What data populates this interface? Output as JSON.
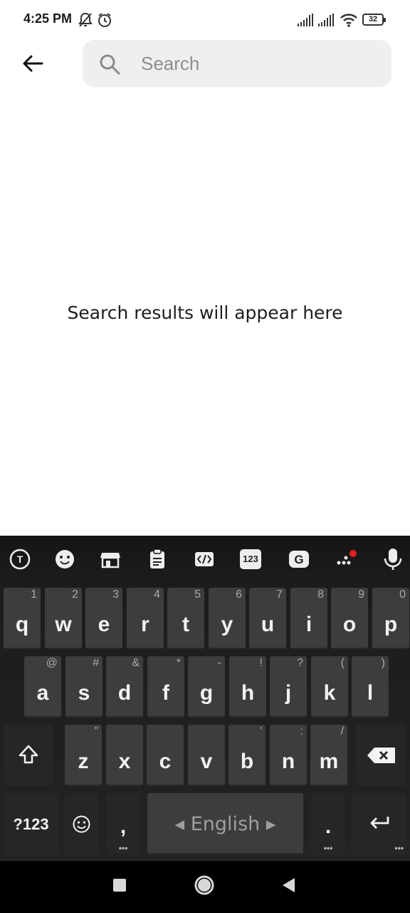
{
  "status": {
    "time": "4:25 PM",
    "battery": "32",
    "icons": [
      "bell-off-icon",
      "alarm-icon",
      "signal-icon",
      "signal-icon",
      "wifi-icon",
      "battery-icon"
    ]
  },
  "header": {
    "back_icon": "arrow-left-icon",
    "search_icon": "search-icon",
    "search_placeholder": "Search",
    "search_value": ""
  },
  "main": {
    "empty_message": "Search results will appear here"
  },
  "keyboard": {
    "toolbar": [
      "translate-icon",
      "emoji-icon",
      "store-icon",
      "clipboard-icon",
      "text-edit-icon",
      "numbers-icon",
      "gif-icon",
      "more-icon",
      "mic-icon"
    ],
    "toolbar_numbers_label": "123",
    "row1": [
      {
        "ch": "q",
        "hint": "1"
      },
      {
        "ch": "w",
        "hint": "2"
      },
      {
        "ch": "e",
        "hint": "3"
      },
      {
        "ch": "r",
        "hint": "4"
      },
      {
        "ch": "t",
        "hint": "5"
      },
      {
        "ch": "y",
        "hint": "6"
      },
      {
        "ch": "u",
        "hint": "7"
      },
      {
        "ch": "i",
        "hint": "8"
      },
      {
        "ch": "o",
        "hint": "9"
      },
      {
        "ch": "p",
        "hint": "0"
      }
    ],
    "row2": [
      {
        "ch": "a",
        "hint": "@"
      },
      {
        "ch": "s",
        "hint": "#"
      },
      {
        "ch": "d",
        "hint": "&"
      },
      {
        "ch": "f",
        "hint": "*"
      },
      {
        "ch": "g",
        "hint": "-"
      },
      {
        "ch": "h",
        "hint": "!"
      },
      {
        "ch": "j",
        "hint": "?"
      },
      {
        "ch": "k",
        "hint": "("
      },
      {
        "ch": "l",
        "hint": ")"
      }
    ],
    "row3": [
      {
        "ch": "z",
        "hint": "\""
      },
      {
        "ch": "x",
        "hint": ""
      },
      {
        "ch": "c",
        "hint": ""
      },
      {
        "ch": "v",
        "hint": ""
      },
      {
        "ch": "b",
        "hint": "'"
      },
      {
        "ch": "n",
        "hint": ":"
      },
      {
        "ch": "m",
        "hint": "/"
      }
    ],
    "symbols_label": "?123",
    "comma_label": ",",
    "space_label": "English",
    "period_label": ".",
    "shift_icon": "shift-icon",
    "backspace_icon": "backspace-icon",
    "enter_icon": "enter-icon",
    "emoji_key_icon": "emoji-icon"
  },
  "nav": [
    "recents-icon",
    "home-icon",
    "back-icon"
  ]
}
